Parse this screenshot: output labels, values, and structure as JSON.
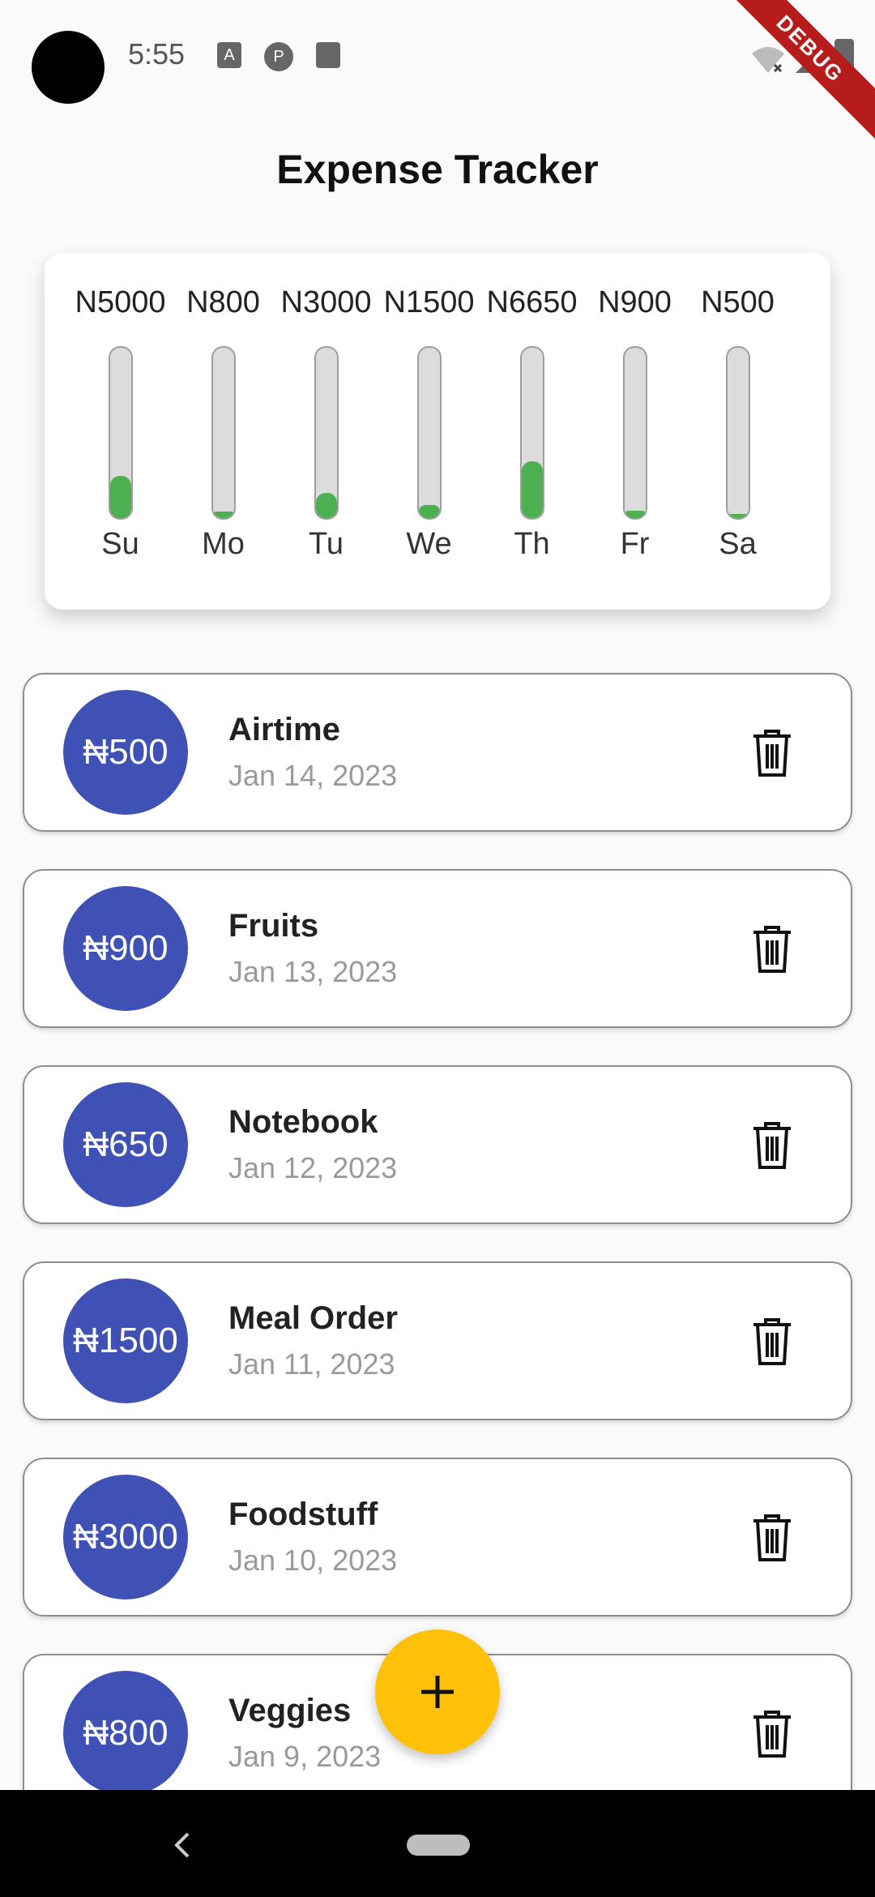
{
  "status_bar": {
    "time": "5:55",
    "debug_label": "DEBUG"
  },
  "app": {
    "title": "Expense Tracker"
  },
  "chart_data": {
    "type": "bar",
    "categories": [
      "Su",
      "Mo",
      "Tu",
      "We",
      "Th",
      "Fr",
      "Sa"
    ],
    "amount_labels": [
      "N5000",
      "N800",
      "N3000",
      "N1500",
      "N6650",
      "N900",
      "N500"
    ],
    "values": [
      5000,
      800,
      3000,
      1500,
      6650,
      900,
      500
    ],
    "fill_fractions": [
      0.25,
      0.04,
      0.15,
      0.075,
      0.3325,
      0.045,
      0.025
    ],
    "bar_color": "#4caf50",
    "track_color": "#dcdcdc"
  },
  "expenses": [
    {
      "amount": "₦500",
      "title": "Airtime",
      "date": "Jan 14, 2023"
    },
    {
      "amount": "₦900",
      "title": "Fruits",
      "date": "Jan 13, 2023"
    },
    {
      "amount": "₦650",
      "title": "Notebook",
      "date": "Jan 12, 2023"
    },
    {
      "amount": "₦1500",
      "title": "Meal Order",
      "date": "Jan 11, 2023"
    },
    {
      "amount": "₦3000",
      "title": "Foodstuff",
      "date": "Jan 10, 2023"
    },
    {
      "amount": "₦800",
      "title": "Veggies",
      "date": "Jan 9, 2023"
    }
  ],
  "colors": {
    "avatar": "#3f51b5",
    "fab": "#ffc107"
  },
  "icons": {
    "delete": "trash-icon",
    "add": "plus-icon",
    "back": "chevron-left-icon"
  }
}
